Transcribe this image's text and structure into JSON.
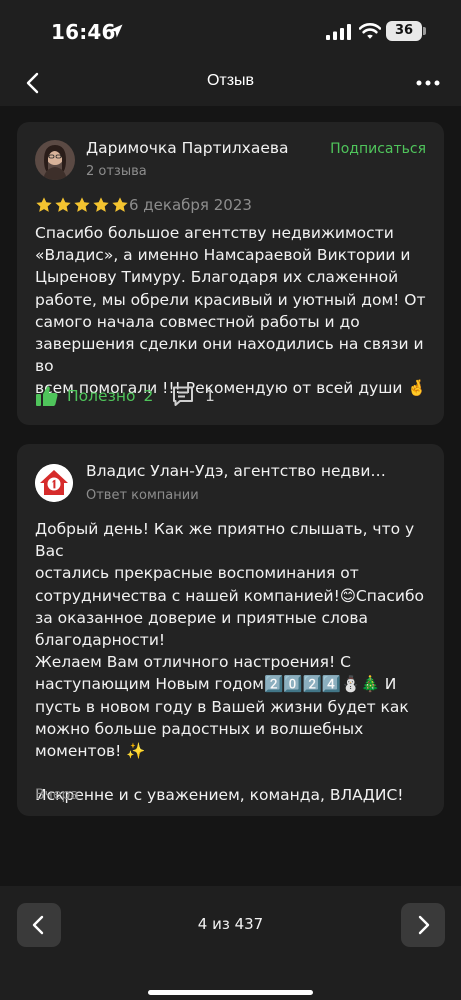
{
  "status_bar": {
    "time": "16:46",
    "battery": "36",
    "icons": [
      "location-arrow-icon",
      "cellular-signal-icon",
      "wifi-icon",
      "battery-icon"
    ]
  },
  "nav": {
    "title": "Отзыв",
    "back_icon": "chevron-left-icon",
    "more_icon": "more-horizontal-icon"
  },
  "review": {
    "author": "Даримочка Партилхаева",
    "author_reviews": "2 отзыва",
    "subscribe": "Подписаться",
    "rating": 5,
    "date": "6 декабря 2023",
    "text": "Спасибо большое агентству недвижимости\n«Владис», а именно Намсараевой Виктории и\nЦыренову Тимуру. Благодаря их слаженной\nработе, мы обрели красивый и уютный дом! От\nсамого начала совместной работы и до\nзавершения сделки они находились на связи и во\nвсем помогали !!! Рекомендую от всей души 🤞",
    "useful_label": "Полезно",
    "useful_count": "2",
    "comments_count": "1",
    "accent_color": "#4fc45b",
    "star_color": "#f4c430"
  },
  "reply": {
    "company": "Владис Улан-Удэ, агентство недви…",
    "role": "Ответ компании",
    "text": "Добрый день! Как же приятно слышать, что у Вас\nостались прекрасные воспоминания от\nсотрудничества с нашей компанией!😊Спасибо\nза оказанное доверие и приятные слова\nблагодарности!\nЖелаем Вам отличного настроения! С\nнаступающим Новым годом2️⃣0️⃣2️⃣4️⃣⛄🎄 И\nпусть в новом году в Вашей жизни будет как\nможно больше радостных и волшебных\nмоментов! ✨\n\nИскренне и с уважением, команда, ВЛАДИС!",
    "date": "Вчера",
    "logo_color": "#d62b2b"
  },
  "pager": {
    "label": "4 из 437",
    "prev_icon": "chevron-left-icon",
    "next_icon": "chevron-right-icon"
  }
}
